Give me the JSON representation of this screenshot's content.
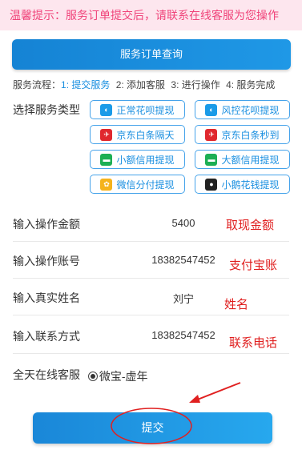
{
  "notice": "温馨提示：服务订单提交后，请联系在线客服为您操作",
  "query_button": "服务订单查询",
  "flow": {
    "title": "服务流程：",
    "steps": [
      "1: 提交服务",
      "2: 添加客服",
      "3: 进行操作",
      "4: 服务完成"
    ],
    "active_index": 0
  },
  "service": {
    "label": "选择服务类型",
    "options": [
      {
        "label": "正常花呗提现",
        "icon": "huabei-icon"
      },
      {
        "label": "风控花呗提现",
        "icon": "huabei-icon"
      },
      {
        "label": "京东白条隔天",
        "icon": "jd-icon"
      },
      {
        "label": "京东白条秒到",
        "icon": "jd-icon"
      },
      {
        "label": "小额信用提现",
        "icon": "card-icon"
      },
      {
        "label": "大额信用提现",
        "icon": "card-icon"
      },
      {
        "label": "微信分付提现",
        "icon": "wechat-pay-icon"
      },
      {
        "label": "小鹅花钱提现",
        "icon": "penguin-icon"
      }
    ]
  },
  "form": {
    "amount": {
      "label": "输入操作金额",
      "value": "5400"
    },
    "account": {
      "label": "输入操作账号",
      "value": "18382547452"
    },
    "name": {
      "label": "输入真实姓名",
      "value": "刘宁"
    },
    "contact": {
      "label": "输入联系方式",
      "value": "18382547452"
    }
  },
  "customer_service": {
    "label": "全天在线客服",
    "option": "微宝-虚年"
  },
  "annotations": {
    "amount": "取现金额",
    "account": "支付宝账",
    "name": "姓名",
    "contact": "联系电话"
  },
  "submit_button": "提交",
  "colors": {
    "accent": "#1a8fe0",
    "notice_bg": "#fde6ee",
    "notice_text": "#f0447a",
    "annotation": "#e02020"
  }
}
